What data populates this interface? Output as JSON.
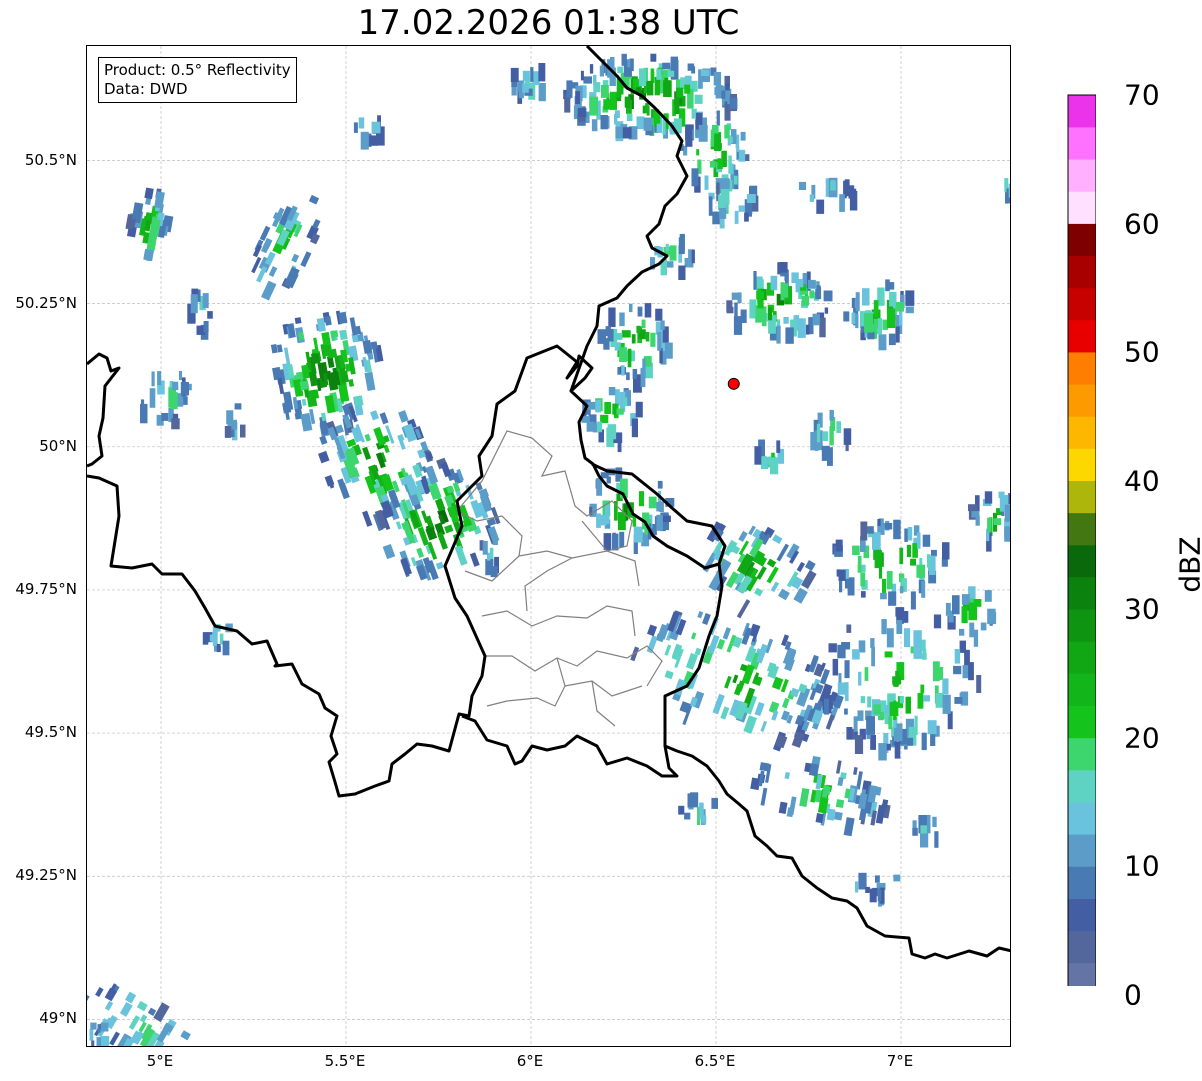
{
  "title": "17.02.2026 01:38 UTC",
  "info_box": {
    "product": "Product: 0.5° Reflectivity",
    "data": "Data: DWD"
  },
  "map": {
    "extent": {
      "lon_min": 4.8,
      "lon_max": 7.3,
      "lat_min": 48.95,
      "lat_max": 50.7
    },
    "lat_ticks": [
      {
        "value": 50.5,
        "label": "50.5°N"
      },
      {
        "value": 50.25,
        "label": "50.25°N"
      },
      {
        "value": 50.0,
        "label": "50°N"
      },
      {
        "value": 49.75,
        "label": "49.75°N"
      },
      {
        "value": 49.5,
        "label": "49.5°N"
      },
      {
        "value": 49.25,
        "label": "49.25°N"
      },
      {
        "value": 49.0,
        "label": "49°N"
      }
    ],
    "lon_ticks": [
      {
        "value": 5.0,
        "label": "5°E"
      },
      {
        "value": 5.5,
        "label": "5.5°E"
      },
      {
        "value": 6.0,
        "label": "6°E"
      },
      {
        "value": 6.5,
        "label": "6.5°E"
      },
      {
        "value": 7.0,
        "label": "7°E"
      }
    ],
    "grid": true,
    "radar_site": {
      "lon": 6.548,
      "lat": 50.11,
      "color": "#ff0000"
    },
    "border_color": "#000000",
    "district_color": "#808080"
  },
  "colorbar": {
    "unit": "dBZ",
    "min": 0,
    "max": 70,
    "tick_values": [
      0,
      10,
      20,
      30,
      40,
      50,
      60,
      70
    ],
    "colors": [
      "#6475a5",
      "#53679d",
      "#445ea4",
      "#4a7ab3",
      "#5b9cc9",
      "#6ac3dc",
      "#5fd3c3",
      "#3cd56e",
      "#14c41d",
      "#12b51a",
      "#11a614",
      "#0f9411",
      "#0c820e",
      "#0a6a0b",
      "#437712",
      "#adb60a",
      "#fcd700",
      "#fdb700",
      "#fd9a00",
      "#fd7e00",
      "#e80000",
      "#c70000",
      "#a80000",
      "#7f0000",
      "#ffe0ff",
      "#ffb0ff",
      "#ff72ff",
      "#ea33ea"
    ]
  }
}
